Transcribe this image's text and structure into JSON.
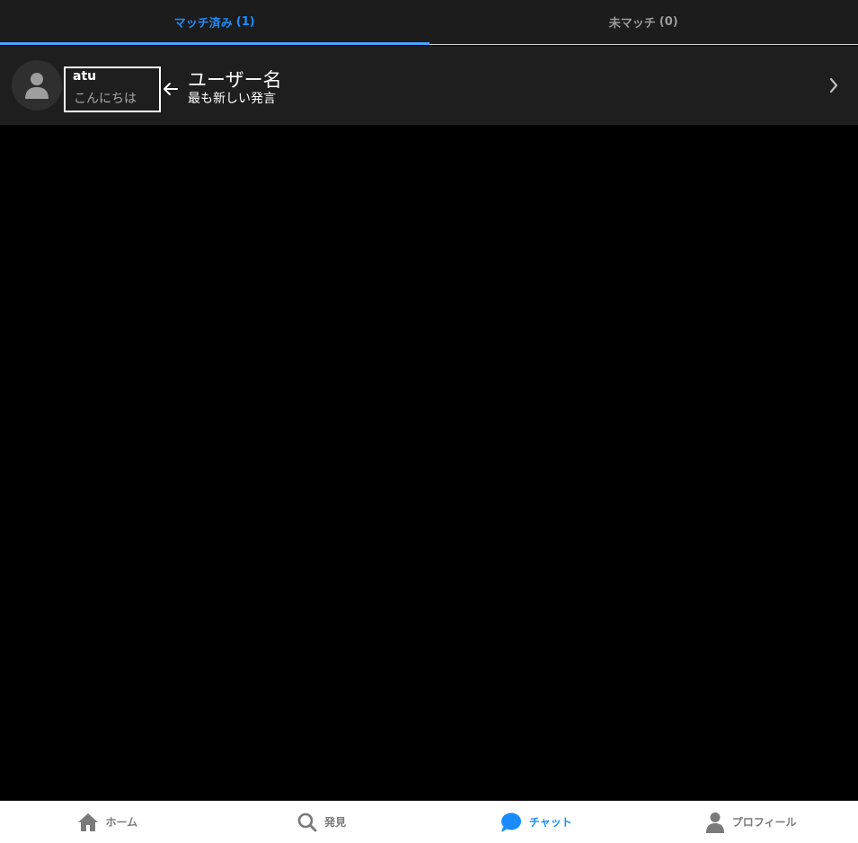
{
  "tabs": [
    {
      "label": "マッチ済み",
      "count": "(1)",
      "active": true
    },
    {
      "label": "未マッチ",
      "count": "(0)",
      "active": false
    }
  ],
  "chat_list": [
    {
      "user_name": "atu",
      "last_message": "こんにちは",
      "avatar_icon": "user-icon"
    }
  ],
  "annotation": {
    "title": "ユーザー名",
    "subtitle": "最も新しい発言"
  },
  "bottom_nav": [
    {
      "label": "ホーム",
      "icon": "home-icon",
      "active": false
    },
    {
      "label": "発見",
      "icon": "search-icon",
      "active": false
    },
    {
      "label": "チャット",
      "icon": "chat-icon",
      "active": true
    },
    {
      "label": "プロフィール",
      "icon": "user-icon",
      "active": false
    }
  ],
  "colors": {
    "accent": "#1a8cff",
    "background": "#000000",
    "panel": "#1e1e1e",
    "nav_inactive": "#7a7a7a"
  }
}
